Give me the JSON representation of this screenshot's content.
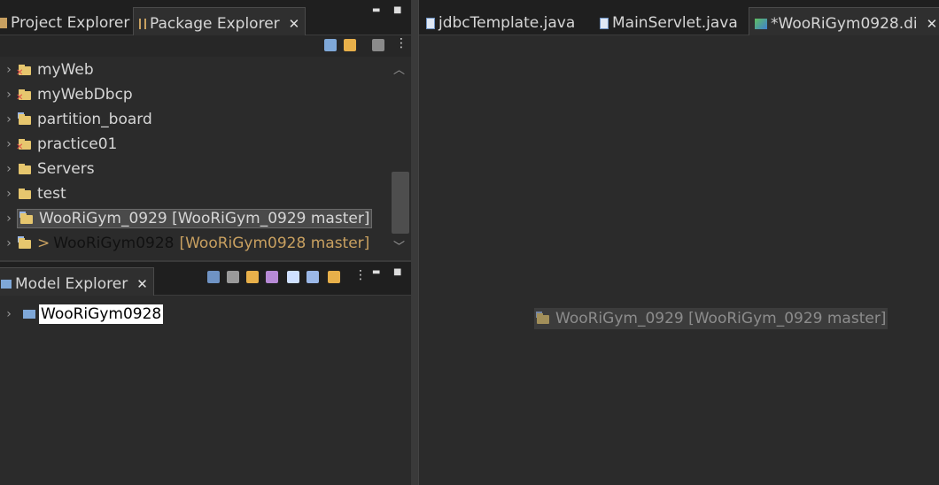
{
  "package_explorer": {
    "tabs": [
      {
        "label": "Project Explorer",
        "icon": "project-explorer-icon"
      },
      {
        "label": "Package Explorer",
        "icon": "package-explorer-icon",
        "active": true,
        "close": "✕"
      }
    ],
    "window_controls": {
      "minimize": "▬",
      "maximize": "■"
    },
    "toolbar_icons": [
      "collapse-all-icon",
      "link-with-editor-icon",
      "filter-icon",
      "view-menu-icon"
    ],
    "items": [
      {
        "label": "myWeb",
        "error": true
      },
      {
        "label": "myWebDbcp",
        "error": true
      },
      {
        "label": "partition_board",
        "error": false
      },
      {
        "label": "practice01",
        "error": true
      },
      {
        "label": "Servers",
        "error": false
      },
      {
        "label": "test",
        "error": false
      },
      {
        "label": "WooRiGym_0929 [WooRiGym_0929 master]",
        "error": false,
        "selected": true
      },
      {
        "prefix": ">",
        "label": "WooRiGym0928",
        "decoration": "[WooRiGym0928 master]",
        "error": false
      }
    ]
  },
  "model_explorer": {
    "tab": {
      "label": "Model Explorer",
      "close": "✕"
    },
    "toolbar_icons": [
      "list-icon",
      "tree-icon",
      "edit-icon",
      "filter-icon",
      "expand-icon",
      "collapse-icon",
      "link-icon",
      "view-menu-icon"
    ],
    "window_controls": {
      "minimize": "▬",
      "maximize": "■"
    },
    "root": {
      "label": "WooRiGym0928"
    }
  },
  "editor": {
    "tabs": [
      {
        "label": "jdbcTemplate.java",
        "icon": "java-file-icon"
      },
      {
        "label": "MainServlet.java",
        "icon": "java-file-icon"
      },
      {
        "label": "*WooRiGym0928.di",
        "icon": "papyrus-diagram-icon",
        "active": true,
        "close": "✕"
      }
    ],
    "drag_ghost": "WooRiGym_0929 [WooRiGym_0929 master]"
  },
  "colors": {
    "background": "#2b2b2b",
    "tab_bar": "#1f1f1f",
    "git_decoration": "#c8a060",
    "error_marker": "#e24a4a"
  }
}
